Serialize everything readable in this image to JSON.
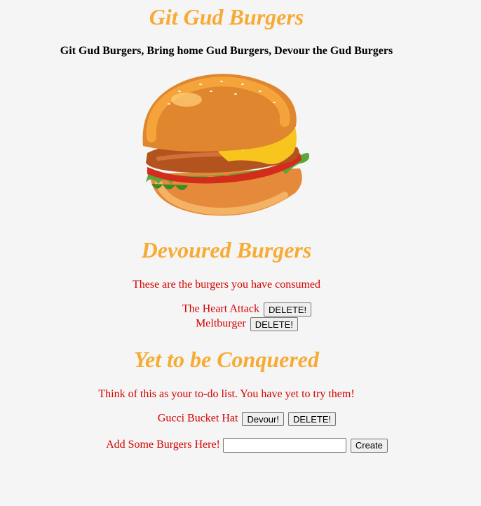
{
  "header": {
    "title": "Git Gud Burgers",
    "tagline": "Git Gud Burgers, Bring home Gud Burgers, Devour the Gud Burgers"
  },
  "hero_image": {
    "icon": "burger-illustration"
  },
  "devoured": {
    "title": "Devoured Burgers",
    "description": "These are the burgers you have consumed",
    "items": [
      {
        "name": "The Heart Attack",
        "delete_label": "DELETE!"
      },
      {
        "name": "Meltburger",
        "delete_label": "DELETE!"
      }
    ]
  },
  "todo": {
    "title": "Yet to be Conquered",
    "description": "Think of this as your to-do list. You have yet to try them!",
    "items": [
      {
        "name": "Gucci Bucket Hat",
        "devour_label": "Devour!",
        "delete_label": "DELETE!"
      }
    ]
  },
  "add_form": {
    "label": "Add Some Burgers Here!",
    "input_value": "",
    "input_placeholder": "",
    "create_label": "Create"
  },
  "colors": {
    "title_orange": "#f7ab34",
    "text_red": "#d40000",
    "background": "#f5f5f5"
  }
}
